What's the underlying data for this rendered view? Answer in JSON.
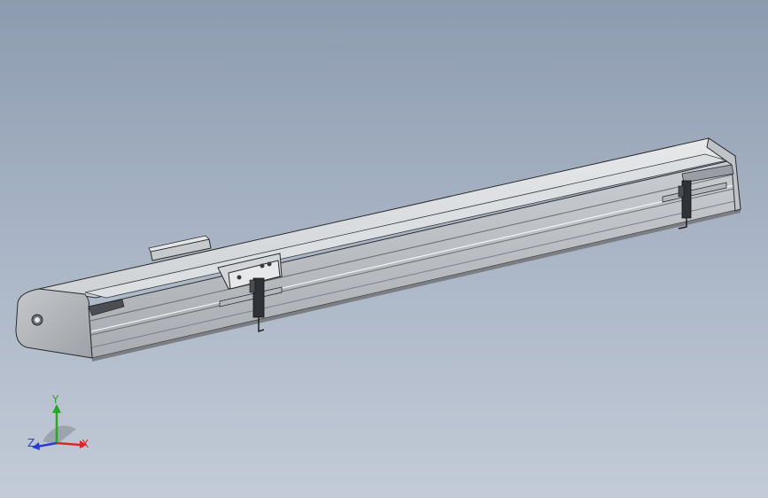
{
  "viewport": {
    "background_top": "#8d9bb0",
    "background_bottom": "#c2cbd7"
  },
  "model": {
    "name_icon": "linear-actuator-assembly",
    "body_color": "#d6d8da",
    "edge_color": "#2b2b2b",
    "shadow_color": "#8e9296"
  },
  "triad": {
    "x_label": "X",
    "y_label": "Y",
    "z_label": "Z",
    "x_color": "#d42a2a",
    "y_color": "#2aa52a",
    "z_color": "#2a3bd4"
  }
}
